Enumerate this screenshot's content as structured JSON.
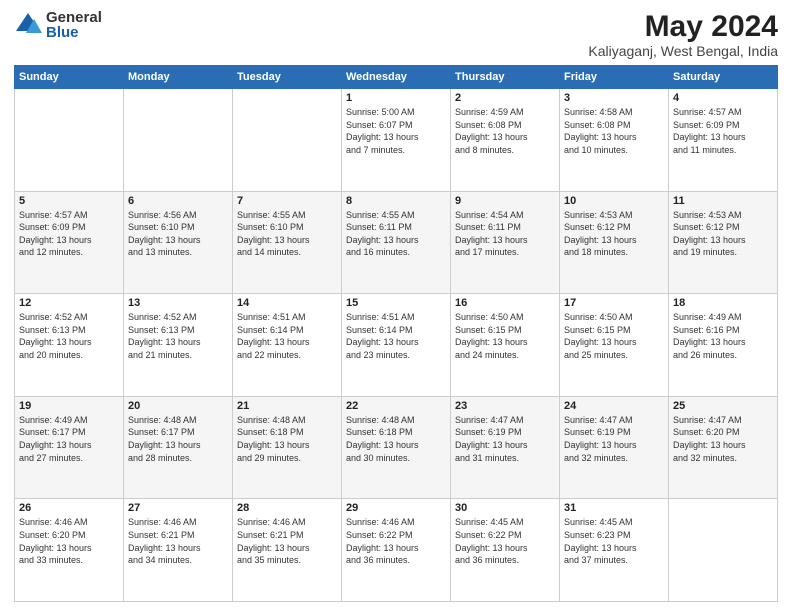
{
  "logo": {
    "general": "General",
    "blue": "Blue"
  },
  "title": "May 2024",
  "subtitle": "Kaliyaganj, West Bengal, India",
  "days": [
    "Sunday",
    "Monday",
    "Tuesday",
    "Wednesday",
    "Thursday",
    "Friday",
    "Saturday"
  ],
  "weeks": [
    [
      {
        "num": "",
        "lines": []
      },
      {
        "num": "",
        "lines": []
      },
      {
        "num": "",
        "lines": []
      },
      {
        "num": "1",
        "lines": [
          "Sunrise: 5:00 AM",
          "Sunset: 6:07 PM",
          "Daylight: 13 hours",
          "and 7 minutes."
        ]
      },
      {
        "num": "2",
        "lines": [
          "Sunrise: 4:59 AM",
          "Sunset: 6:08 PM",
          "Daylight: 13 hours",
          "and 8 minutes."
        ]
      },
      {
        "num": "3",
        "lines": [
          "Sunrise: 4:58 AM",
          "Sunset: 6:08 PM",
          "Daylight: 13 hours",
          "and 10 minutes."
        ]
      },
      {
        "num": "4",
        "lines": [
          "Sunrise: 4:57 AM",
          "Sunset: 6:09 PM",
          "Daylight: 13 hours",
          "and 11 minutes."
        ]
      }
    ],
    [
      {
        "num": "5",
        "lines": [
          "Sunrise: 4:57 AM",
          "Sunset: 6:09 PM",
          "Daylight: 13 hours",
          "and 12 minutes."
        ]
      },
      {
        "num": "6",
        "lines": [
          "Sunrise: 4:56 AM",
          "Sunset: 6:10 PM",
          "Daylight: 13 hours",
          "and 13 minutes."
        ]
      },
      {
        "num": "7",
        "lines": [
          "Sunrise: 4:55 AM",
          "Sunset: 6:10 PM",
          "Daylight: 13 hours",
          "and 14 minutes."
        ]
      },
      {
        "num": "8",
        "lines": [
          "Sunrise: 4:55 AM",
          "Sunset: 6:11 PM",
          "Daylight: 13 hours",
          "and 16 minutes."
        ]
      },
      {
        "num": "9",
        "lines": [
          "Sunrise: 4:54 AM",
          "Sunset: 6:11 PM",
          "Daylight: 13 hours",
          "and 17 minutes."
        ]
      },
      {
        "num": "10",
        "lines": [
          "Sunrise: 4:53 AM",
          "Sunset: 6:12 PM",
          "Daylight: 13 hours",
          "and 18 minutes."
        ]
      },
      {
        "num": "11",
        "lines": [
          "Sunrise: 4:53 AM",
          "Sunset: 6:12 PM",
          "Daylight: 13 hours",
          "and 19 minutes."
        ]
      }
    ],
    [
      {
        "num": "12",
        "lines": [
          "Sunrise: 4:52 AM",
          "Sunset: 6:13 PM",
          "Daylight: 13 hours",
          "and 20 minutes."
        ]
      },
      {
        "num": "13",
        "lines": [
          "Sunrise: 4:52 AM",
          "Sunset: 6:13 PM",
          "Daylight: 13 hours",
          "and 21 minutes."
        ]
      },
      {
        "num": "14",
        "lines": [
          "Sunrise: 4:51 AM",
          "Sunset: 6:14 PM",
          "Daylight: 13 hours",
          "and 22 minutes."
        ]
      },
      {
        "num": "15",
        "lines": [
          "Sunrise: 4:51 AM",
          "Sunset: 6:14 PM",
          "Daylight: 13 hours",
          "and 23 minutes."
        ]
      },
      {
        "num": "16",
        "lines": [
          "Sunrise: 4:50 AM",
          "Sunset: 6:15 PM",
          "Daylight: 13 hours",
          "and 24 minutes."
        ]
      },
      {
        "num": "17",
        "lines": [
          "Sunrise: 4:50 AM",
          "Sunset: 6:15 PM",
          "Daylight: 13 hours",
          "and 25 minutes."
        ]
      },
      {
        "num": "18",
        "lines": [
          "Sunrise: 4:49 AM",
          "Sunset: 6:16 PM",
          "Daylight: 13 hours",
          "and 26 minutes."
        ]
      }
    ],
    [
      {
        "num": "19",
        "lines": [
          "Sunrise: 4:49 AM",
          "Sunset: 6:17 PM",
          "Daylight: 13 hours",
          "and 27 minutes."
        ]
      },
      {
        "num": "20",
        "lines": [
          "Sunrise: 4:48 AM",
          "Sunset: 6:17 PM",
          "Daylight: 13 hours",
          "and 28 minutes."
        ]
      },
      {
        "num": "21",
        "lines": [
          "Sunrise: 4:48 AM",
          "Sunset: 6:18 PM",
          "Daylight: 13 hours",
          "and 29 minutes."
        ]
      },
      {
        "num": "22",
        "lines": [
          "Sunrise: 4:48 AM",
          "Sunset: 6:18 PM",
          "Daylight: 13 hours",
          "and 30 minutes."
        ]
      },
      {
        "num": "23",
        "lines": [
          "Sunrise: 4:47 AM",
          "Sunset: 6:19 PM",
          "Daylight: 13 hours",
          "and 31 minutes."
        ]
      },
      {
        "num": "24",
        "lines": [
          "Sunrise: 4:47 AM",
          "Sunset: 6:19 PM",
          "Daylight: 13 hours",
          "and 32 minutes."
        ]
      },
      {
        "num": "25",
        "lines": [
          "Sunrise: 4:47 AM",
          "Sunset: 6:20 PM",
          "Daylight: 13 hours",
          "and 32 minutes."
        ]
      }
    ],
    [
      {
        "num": "26",
        "lines": [
          "Sunrise: 4:46 AM",
          "Sunset: 6:20 PM",
          "Daylight: 13 hours",
          "and 33 minutes."
        ]
      },
      {
        "num": "27",
        "lines": [
          "Sunrise: 4:46 AM",
          "Sunset: 6:21 PM",
          "Daylight: 13 hours",
          "and 34 minutes."
        ]
      },
      {
        "num": "28",
        "lines": [
          "Sunrise: 4:46 AM",
          "Sunset: 6:21 PM",
          "Daylight: 13 hours",
          "and 35 minutes."
        ]
      },
      {
        "num": "29",
        "lines": [
          "Sunrise: 4:46 AM",
          "Sunset: 6:22 PM",
          "Daylight: 13 hours",
          "and 36 minutes."
        ]
      },
      {
        "num": "30",
        "lines": [
          "Sunrise: 4:45 AM",
          "Sunset: 6:22 PM",
          "Daylight: 13 hours",
          "and 36 minutes."
        ]
      },
      {
        "num": "31",
        "lines": [
          "Sunrise: 4:45 AM",
          "Sunset: 6:23 PM",
          "Daylight: 13 hours",
          "and 37 minutes."
        ]
      },
      {
        "num": "",
        "lines": []
      }
    ]
  ]
}
